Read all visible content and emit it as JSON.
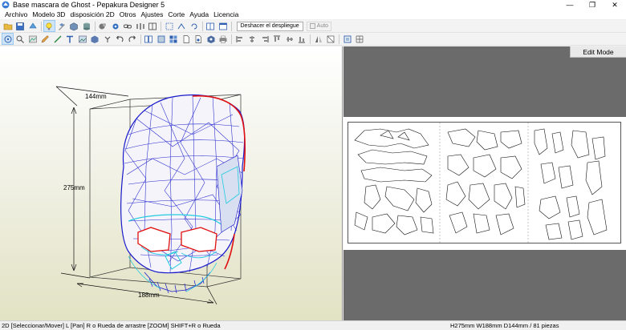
{
  "window": {
    "title": "Base mascara de Ghost - Pepakura Designer 5",
    "minimize_glyph": "—",
    "maximize_glyph": "❐",
    "close_glyph": "✕"
  },
  "menu": [
    "Archivo",
    "Modelo 3D",
    "disposición 2D",
    "Otros",
    "Ajustes",
    "Corte",
    "Ayuda",
    "Licencia"
  ],
  "toolbar1": {
    "icons": [
      "open-file-icon",
      "save-icon",
      "rotate-view-icon",
      "lightbulb-icon",
      "edit-3d-icon",
      "cube-icon",
      "cylinder-icon",
      "paint-icon",
      "gear-icon",
      "link-icon",
      "flip-icon",
      "split-view-icon",
      "select-icon",
      "fold-icon",
      "rotate-icon",
      "panel-left-icon",
      "panel-right-icon"
    ],
    "undo_unfold_label": "Deshacer el despliegue",
    "auto_label": "Auto"
  },
  "toolbar2": {
    "icons": [
      "orbit-icon",
      "zoom-icon",
      "texture-icon",
      "pencil-icon",
      "line-icon",
      "text-icon",
      "image-icon",
      "cut-icon",
      "join-icon",
      "undo-icon",
      "redo-icon",
      "pages-icon",
      "fit-icon",
      "arrange-icon",
      "page-icon",
      "print-preview-icon",
      "stamp-icon",
      "printer-icon",
      "align-left-icon",
      "align-center-icon",
      "align-right-icon",
      "align-top-icon",
      "align-middle-icon",
      "align-bottom-icon",
      "mirror-icon",
      "flip-page-icon",
      "select-area-icon",
      "grid-icon"
    ]
  },
  "view3d": {
    "dim_depth": "144mm",
    "dim_height": "275mm",
    "dim_width": "188mm"
  },
  "view2d": {
    "mode_label": "Edit Mode"
  },
  "status": {
    "left": "2D [Seleccionar/Mover] L [Pan] R o Rueda de arrastre [ZOOM] SHIFT+R o Rueda",
    "right": "H275mm W188mm D144mm / 81 piezas"
  },
  "colors": {
    "mesh": "#1a1acc",
    "mesh_light": "#22cce0",
    "edge_red": "#e01010",
    "window_bg": "#f0f0f0"
  }
}
